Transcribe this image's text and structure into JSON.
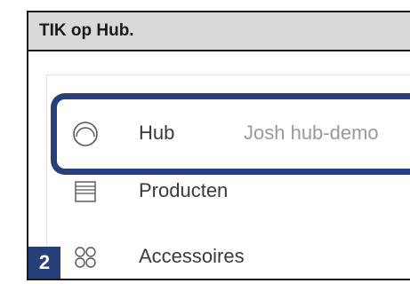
{
  "title": "TIK op Hub.",
  "step_number": "2",
  "highlight_color": "#27407a",
  "menu": {
    "items": [
      {
        "icon": "circle-icon",
        "label": "Hub",
        "sub": "Josh hub-demo"
      },
      {
        "icon": "list-icon",
        "label": "Producten"
      },
      {
        "icon": "four-circles-icon",
        "label": "Accessoires"
      }
    ]
  }
}
